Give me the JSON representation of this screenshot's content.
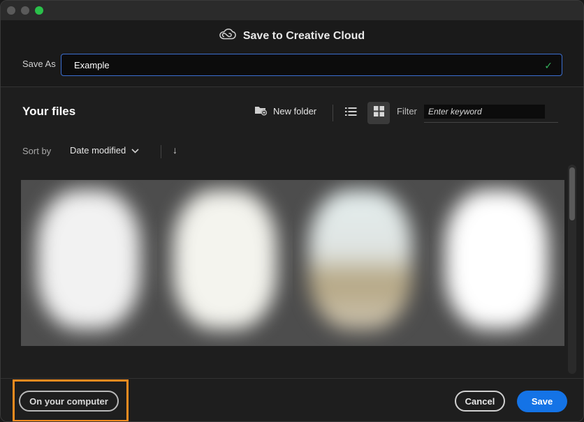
{
  "dialog": {
    "title": "Save to Creative Cloud"
  },
  "save_as": {
    "label": "Save As",
    "value": "Example"
  },
  "files": {
    "title": "Your files",
    "new_folder_label": "New folder",
    "filter_label": "Filter",
    "filter_placeholder": "Enter keyword",
    "view_mode": "grid"
  },
  "sort": {
    "label": "Sort by",
    "selected": "Date modified",
    "direction_glyph": "↓"
  },
  "thumbnails_count_visible": 4,
  "footer": {
    "on_computer_label": "On your computer",
    "cancel_label": "Cancel",
    "save_label": "Save"
  },
  "colors": {
    "accent": "#1473e6",
    "highlight": "#f28b1f",
    "check": "#33b35c",
    "focus_border": "#3b6fd1"
  },
  "icons": [
    "creative-cloud-icon",
    "checkmark-icon",
    "new-folder-icon",
    "list-view-icon",
    "grid-view-icon",
    "chevron-down-icon",
    "arrow-down-icon"
  ]
}
